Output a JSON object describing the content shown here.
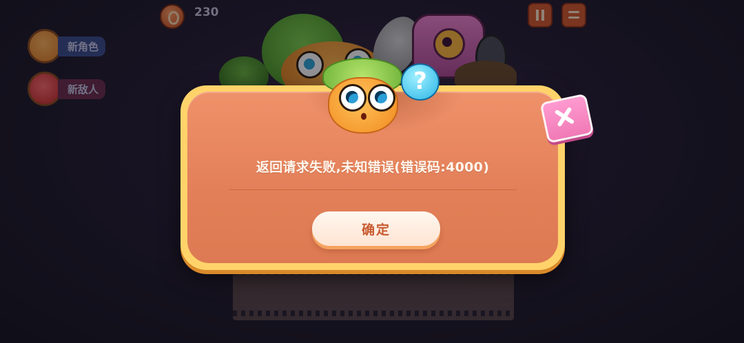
{
  "hud": {
    "coin_count": "230"
  },
  "side_buttons": [
    {
      "label": "新角色"
    },
    {
      "label": "新敌人"
    }
  ],
  "dialog": {
    "message": "返回请求失败,未知错误(错误码:4000)",
    "confirm_label": "确定",
    "mascot_question": "?"
  },
  "colors": {
    "dialog_border": "#ffd36a",
    "dialog_fill": "#e8875f",
    "confirm_text": "#c85a30",
    "close_button": "#f48ac2"
  }
}
